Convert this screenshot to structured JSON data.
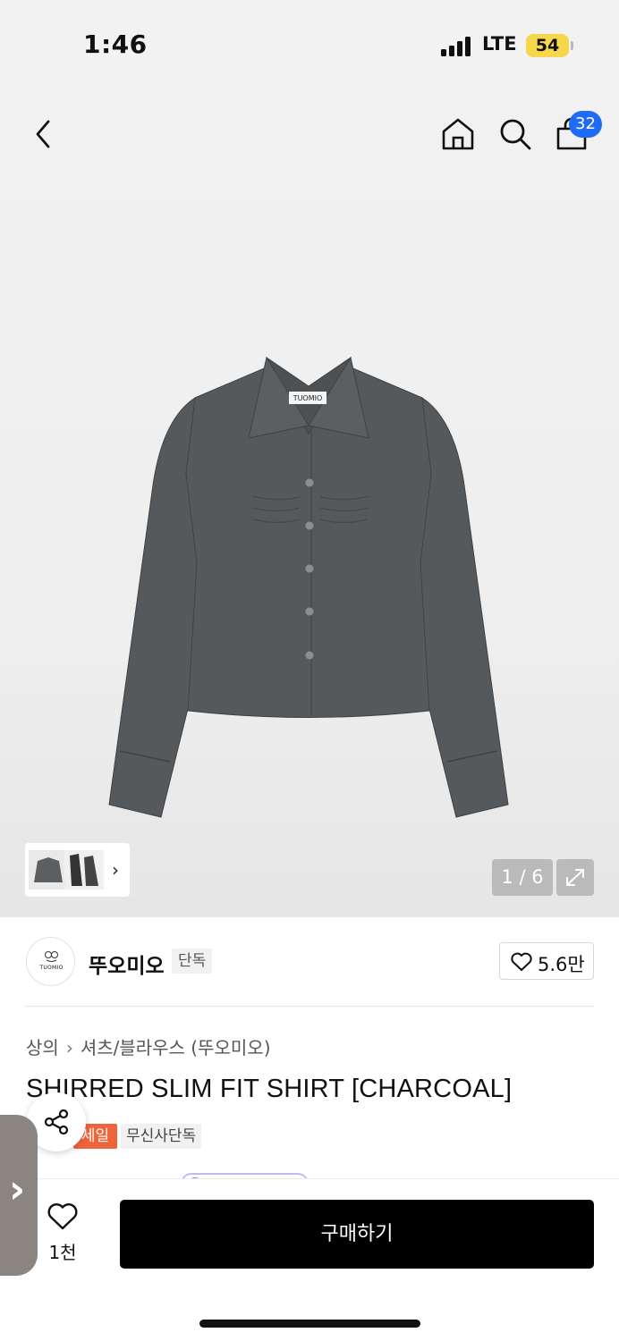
{
  "status_bar": {
    "time": "1:46",
    "network": "LTE",
    "battery": "54"
  },
  "nav": {
    "cart_count": "32"
  },
  "gallery": {
    "counter": "1 / 6"
  },
  "brand": {
    "name": "뚜오미오",
    "tag": "단독",
    "logo_text": "TUOMIO",
    "likes": "5.6만"
  },
  "breadcrumb": {
    "category": "상의",
    "sub": "셔츠/블라우스 (뚜오미오)"
  },
  "product": {
    "title": "SHIRRED SLIM FIT SHIRT [CHARCOAL]",
    "sale_tag": "세일",
    "exclusive_tag": "무신사단독"
  },
  "bottom": {
    "wish_count": "1천",
    "buy_label": "구매하기"
  },
  "colors": {
    "accent_blue": "#1f6bf5",
    "sale_orange": "#f0643c",
    "shirt": "#55595c"
  }
}
